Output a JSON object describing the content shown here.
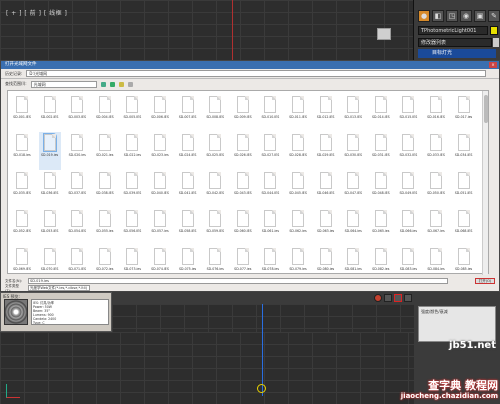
{
  "viewport_top": {
    "label": "[ + ] [ 前 ] [ 线框 ]"
  },
  "command_panel": {
    "object_name": "TPhotometricLight001",
    "color": "#e7e000",
    "modifier_list": "修改器列表",
    "modifier_item": "目标灯光",
    "icons": [
      "light-icon",
      "create-icon",
      "modify-icon",
      "hierarchy-icon",
      "display-icon",
      "utilities-icon"
    ]
  },
  "dialog": {
    "title": "打开光域网文件",
    "close": "×",
    "lookin_label": "查找范围(I):",
    "lookin_value": "光域网",
    "history_label": "历史记录:",
    "history_value": "D:\\光域网",
    "files": [
      "SD-001.IES",
      "SD-002.IES",
      "SD-003.IES",
      "SD-004.IES",
      "SD-005.IES",
      "SD-006.IES",
      "SD-007.IES",
      "SD-008.IES",
      "SD-009.IES",
      "SD-010.IES",
      "SD-011.IES",
      "SD-012.IES",
      "SD-013.IES",
      "SD-014.IES",
      "SD-015.IES",
      "SD-016.IES",
      "SD-017.ies",
      "SD-018.ies",
      "SD-019.ies",
      "SD-020.ies",
      "SD-021.ies",
      "SD-022.ies",
      "SD-023.ies",
      "SD-024.IES",
      "SD-025.IES",
      "SD-026.IES",
      "SD-027.IES",
      "SD-028.IES",
      "SD-029.IES",
      "SD-030.IES",
      "SD-031.IES",
      "SD-032.IES",
      "SD-033.IES",
      "SD-034.IES",
      "SD-035.IES",
      "SD-036.IES",
      "SD-037.IES",
      "SD-038.IES",
      "SD-039.IES",
      "SD-040.IES",
      "SD-041.IES",
      "SD-042.IES",
      "SD-043.IES",
      "SD-044.IES",
      "SD-045.IES",
      "SD-046.IES",
      "SD-047.IES",
      "SD-048.IES",
      "SD-049.IES",
      "SD-050.IES",
      "SD-051.IES",
      "SD-052.IES",
      "SD-053.IES",
      "SD-054.IES",
      "SD-055.ies",
      "SD-056.IES",
      "SD-057.ies",
      "SD-058.IES",
      "SD-059.IES",
      "SD-060.IES",
      "SD-061.ies",
      "SD-062.ies",
      "SD-063.ies",
      "SD-064.ies",
      "SD-065.ies",
      "SD-066.ies",
      "SD-067.ies",
      "SD-068.IES",
      "SD-069.IES",
      "SD-070.IES",
      "SD-071.IES",
      "SD-072.ies",
      "SD-073.ies",
      "SD-074.IES",
      "SD-075.ies",
      "SD-076.ies",
      "SD-077.ies",
      "SD-078.ies",
      "SD-079.ies",
      "SD-080.ies",
      "SD-081.ies",
      "SD-082.ies",
      "SD-083.ies",
      "SD-084.ies",
      "SD-085.ies"
    ],
    "selected_index": 18,
    "filename_label": "文件名(N):",
    "filename_value": "SD-019.ies",
    "filetype_label": "文件类型(T):",
    "filetype_value": "光度学Web文件(*.ies,*.cibse,*.ltli)",
    "open_button": "打开(O)"
  },
  "preview": {
    "label": "IES 预览:",
    "info": "IES: 灯具/功率\nPower: 50W\nBeam: 35°\nLumens: 900\nCandela: 2400\nType: C"
  },
  "right_panel": {
    "text": "强度/颜色/衰减"
  },
  "watermark": {
    "site": "jb51.net",
    "title": "查字典 教程网",
    "sub": "jiaocheng.chazidian.com"
  }
}
